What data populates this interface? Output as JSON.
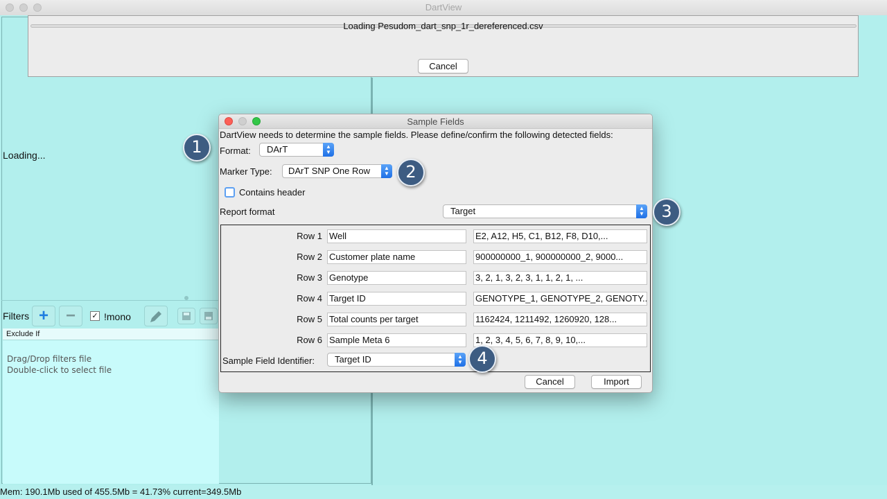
{
  "window": {
    "title": "DartView"
  },
  "main": {
    "loading_text": "Loading...",
    "filters": {
      "label": "Filters",
      "add_icon": "plus-icon",
      "remove_icon": "minus-icon",
      "mono_checked": true,
      "mono_label": "!mono",
      "exclude_header": "Exclude If",
      "drag_drop_line1": "Drag/Drop filters file",
      "drag_drop_line2": "Double-click to select file"
    },
    "status": "Mem: 190.1Mb used of 455.5Mb = 41.73% current=349.5Mb"
  },
  "progress": {
    "label": "Loading Pesudom_dart_snp_1r_dereferenced.csv",
    "cancel_label": "Cancel"
  },
  "dialog": {
    "title": "Sample Fields",
    "instruction": "DartView needs to determine the sample fields. Please define/confirm the following detected fields:",
    "format_label": "Format:",
    "format_value": "DArT",
    "marker_type_label": "Marker Type:",
    "marker_type_value": "DArT SNP One Row",
    "contains_header_label": "Contains header",
    "contains_header_checked": false,
    "report_format_label": "Report format",
    "report_format_value": "Target",
    "rows": [
      {
        "label": "Row 1",
        "name": "Well",
        "values": "E2, A12, H5, C1, B12, F8, D10,..."
      },
      {
        "label": "Row 2",
        "name": "Customer plate name",
        "values": "900000000_1, 900000000_2, 9000..."
      },
      {
        "label": "Row 3",
        "name": "Genotype",
        "values": "3, 2, 1, 3, 2, 3, 1, 1, 2, 1, ..."
      },
      {
        "label": "Row 4",
        "name": "Target ID",
        "values": "GENOTYPE_1, GENOTYPE_2, GENOTY..."
      },
      {
        "label": "Row 5",
        "name": "Total counts per target",
        "values": "1162424, 1211492, 1260920, 128..."
      },
      {
        "label": "Row 6",
        "name": "Sample Meta 6",
        "values": "1, 2, 3, 4, 5, 6, 7, 8, 9, 10,..."
      }
    ],
    "sample_field_identifier_label": "Sample Field Identifier:",
    "sample_field_identifier_value": "Target ID",
    "cancel_label": "Cancel",
    "import_label": "Import"
  },
  "callouts": [
    "1",
    "2",
    "3",
    "4"
  ],
  "colors": {
    "background": "#b2efed",
    "callout": "#3d5c82",
    "select_accent": "#1f70e6"
  }
}
